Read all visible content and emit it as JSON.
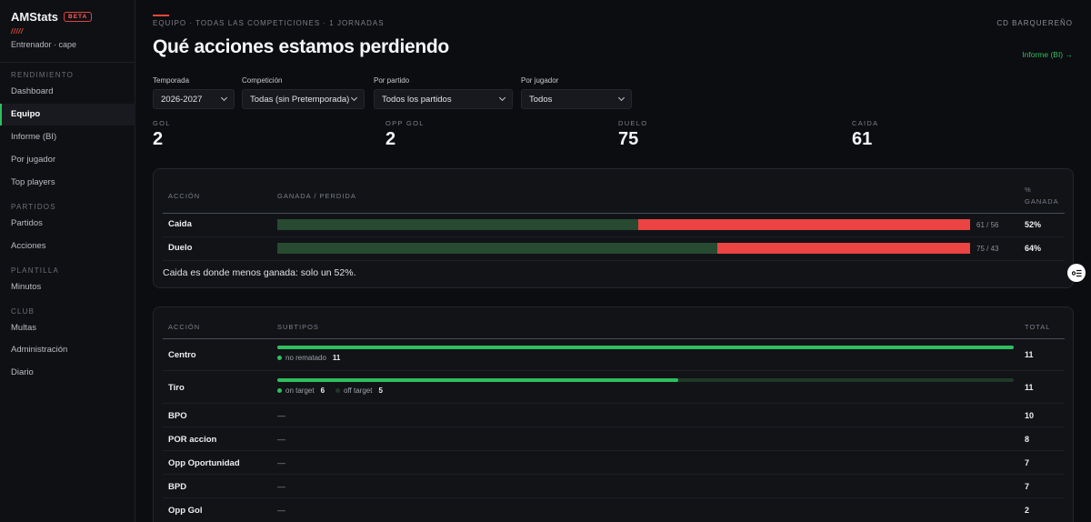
{
  "app": {
    "brand": "AMStats",
    "badge": "BETA",
    "slashes": "/////",
    "user": "Entrenador · cape"
  },
  "sidebar": {
    "sections": [
      {
        "label": "RENDIMIENTO"
      },
      {
        "label": "PARTIDOS"
      },
      {
        "label": "PLANTILLA"
      },
      {
        "label": "CLUB"
      }
    ],
    "items": [
      {
        "label": "Dashboard"
      },
      {
        "label": "Equipo",
        "active": true
      },
      {
        "label": "Informe (BI)"
      },
      {
        "label": "Por jugador"
      },
      {
        "label": "Top players"
      },
      {
        "label": "Partidos"
      },
      {
        "label": "Acciones"
      },
      {
        "label": "Minutos"
      },
      {
        "label": "Multas"
      },
      {
        "label": "Administración"
      },
      {
        "label": "Diario"
      }
    ]
  },
  "header": {
    "breadcrumb": "EQUIPO · TODAS LAS COMPETICIONES · 1 JORNADAS",
    "club": "CD BARQUEREÑO",
    "title": "Qué acciones estamos perdiendo",
    "report_link": "Informe (BI) →"
  },
  "filters": [
    {
      "label": "Temporada",
      "value": "2026-2027"
    },
    {
      "label": "Competición",
      "value": "Todas (sin Pretemporada)"
    },
    {
      "label": "Por partido",
      "value": "Todos los partidos"
    },
    {
      "label": "Por jugador",
      "value": "Todos"
    }
  ],
  "stats": [
    {
      "label": "GOL",
      "value": "2"
    },
    {
      "label": "OPP GOL",
      "value": "2"
    },
    {
      "label": "DUELO",
      "value": "75"
    },
    {
      "label": "CAIDA",
      "value": "61"
    }
  ],
  "won_lost": {
    "headers": {
      "action": "ACCIÓN",
      "bar": "GANADA / PERDIDA",
      "pct_line1": "%",
      "pct_line2": "GANADA"
    },
    "rows": [
      {
        "name": "Caida",
        "won": 61,
        "lost": 56,
        "ratio": "61 / 56",
        "pct": "52%"
      },
      {
        "name": "Duelo",
        "won": 75,
        "lost": 43,
        "ratio": "75 / 43",
        "pct": "64%"
      }
    ],
    "insight": "Caida es donde menos ganada: solo un 52%."
  },
  "subtypes": {
    "headers": {
      "action": "ACCIÓN",
      "subtypes": "SUBTIPOS",
      "total": "TOTAL"
    },
    "rows": [
      {
        "name": "Centro",
        "total": "11",
        "fill": 1.0,
        "legend": [
          {
            "label": "no rematado",
            "value": "11",
            "color": "#2fbf5f"
          }
        ]
      },
      {
        "name": "Tiro",
        "total": "11",
        "fill": 0.545,
        "legend": [
          {
            "label": "on target",
            "value": "6",
            "color": "#2fbf5f"
          },
          {
            "label": "off target",
            "value": "5",
            "color": "#1f3a27"
          }
        ]
      },
      {
        "name": "BPO",
        "total": "10",
        "dash": "—"
      },
      {
        "name": "POR accion",
        "total": "8",
        "dash": "—"
      },
      {
        "name": "Opp Oportunidad",
        "total": "7",
        "dash": "—"
      },
      {
        "name": "BPD",
        "total": "7",
        "dash": "—"
      },
      {
        "name": "Opp Gol",
        "total": "2",
        "dash": "—"
      }
    ]
  },
  "float_button": {
    "icon": "filter-list-icon",
    "glyph": "⚙"
  }
}
